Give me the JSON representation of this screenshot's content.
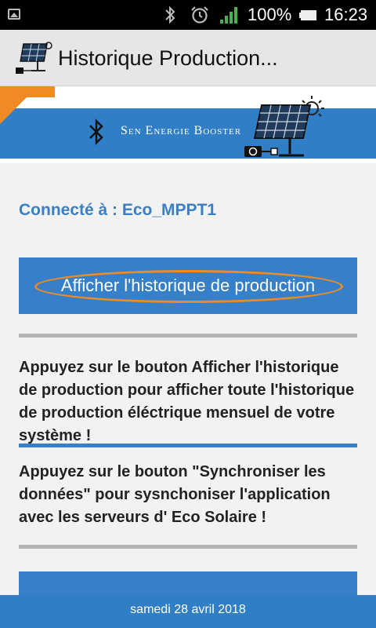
{
  "status_bar": {
    "battery_percent": "100%",
    "time": "16:23",
    "icons": [
      "gallery-icon",
      "bluetooth-icon",
      "alarm-icon",
      "signal-icon",
      "battery-icon"
    ]
  },
  "app_bar": {
    "title": "Historique Production...",
    "icon": "solar-panel-icon"
  },
  "banner": {
    "brand": "Sen Energie Booster",
    "accent_color": "#f08a24",
    "band_color": "#2f7ec6"
  },
  "main": {
    "connected_label": "Connecté à : Eco_MPPT1",
    "show_history_button": "Afficher l'historique de production",
    "instruction_1": "Appuyez sur le bouton Afficher l'historique de production pour afficher toute l'historique de production éléctrique mensuel de votre système !",
    "instruction_2": "Appuyez sur le bouton \"Synchroniser les données\" pour sysnchoniser l'application avec les serveurs d' Eco Solaire !"
  },
  "footer": {
    "date": "samedi 28 avril 2018"
  }
}
